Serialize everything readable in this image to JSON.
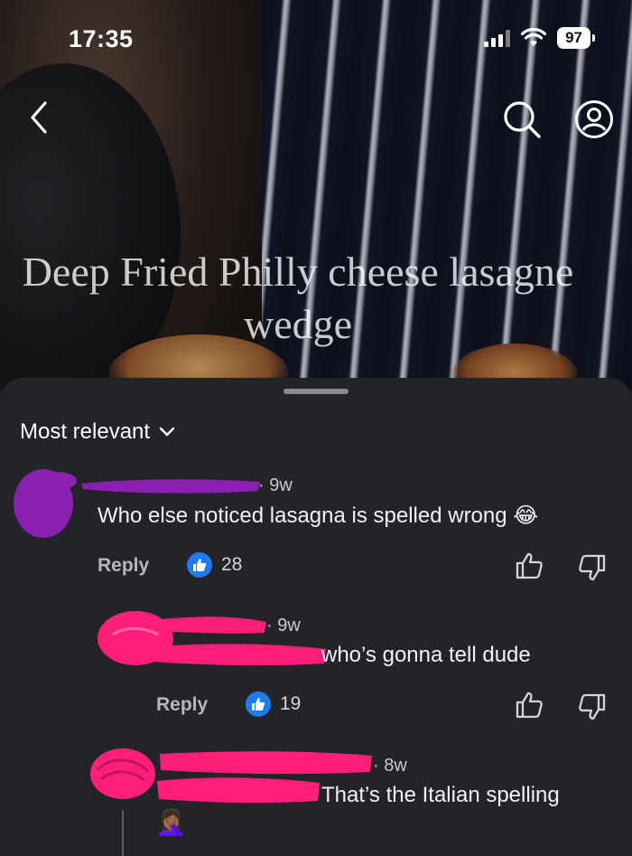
{
  "status": {
    "time": "17:35",
    "battery": "97"
  },
  "video": {
    "title": "Deep Fried Philly cheese lasagne wedge"
  },
  "sheet": {
    "sort_label": "Most relevant"
  },
  "comments": [
    {
      "age": "9w",
      "text": "Who else noticed lasagna is spelled wrong",
      "emoji": "😂",
      "reply_label": "Reply",
      "likes": "28"
    },
    {
      "age": "9w",
      "text": "who’s gonna tell dude",
      "reply_label": "Reply",
      "likes": "19"
    },
    {
      "age": "8w",
      "text": "That’s the Italian spelling",
      "emoji": "🤦🏾‍♀️"
    }
  ],
  "colors": {
    "like_blue": "#1d7cf2",
    "redaction_purple": "#8a1fb0",
    "redaction_pink": "#ff1f7a"
  },
  "icons": [
    "back-chevron-icon",
    "search-icon",
    "profile-icon",
    "chevron-down-icon",
    "thumbs-up-icon",
    "thumbs-down-icon",
    "like-badge-icon"
  ]
}
